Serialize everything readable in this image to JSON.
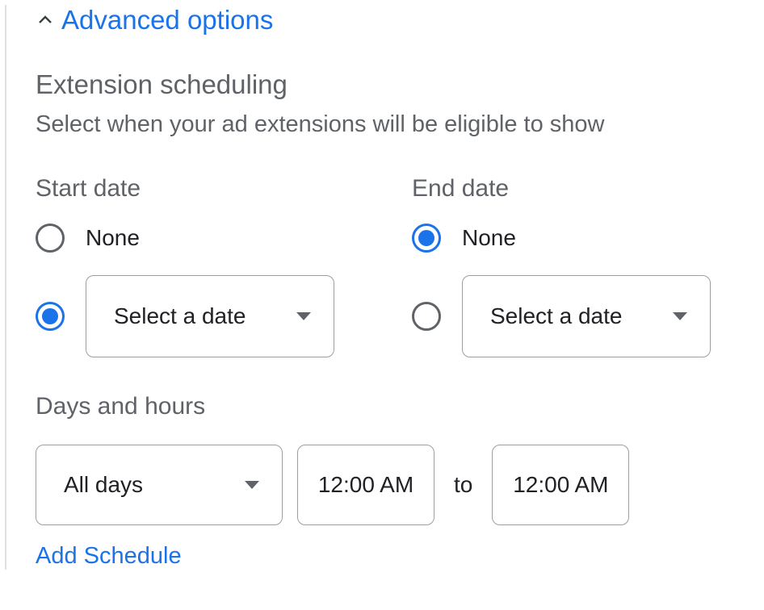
{
  "advanced": {
    "label": "Advanced options"
  },
  "scheduling": {
    "title": "Extension scheduling",
    "description": "Select when your ad extensions will be eligible to show"
  },
  "start_date": {
    "label": "Start date",
    "none_label": "None",
    "select_label": "Select a date",
    "selected": "select"
  },
  "end_date": {
    "label": "End date",
    "none_label": "None",
    "select_label": "Select a date",
    "selected": "none"
  },
  "days_hours": {
    "label": "Days and hours",
    "day_value": "All days",
    "time_start": "12:00 AM",
    "time_end": "12:00 AM",
    "to_label": "to",
    "add_label": "Add Schedule"
  }
}
